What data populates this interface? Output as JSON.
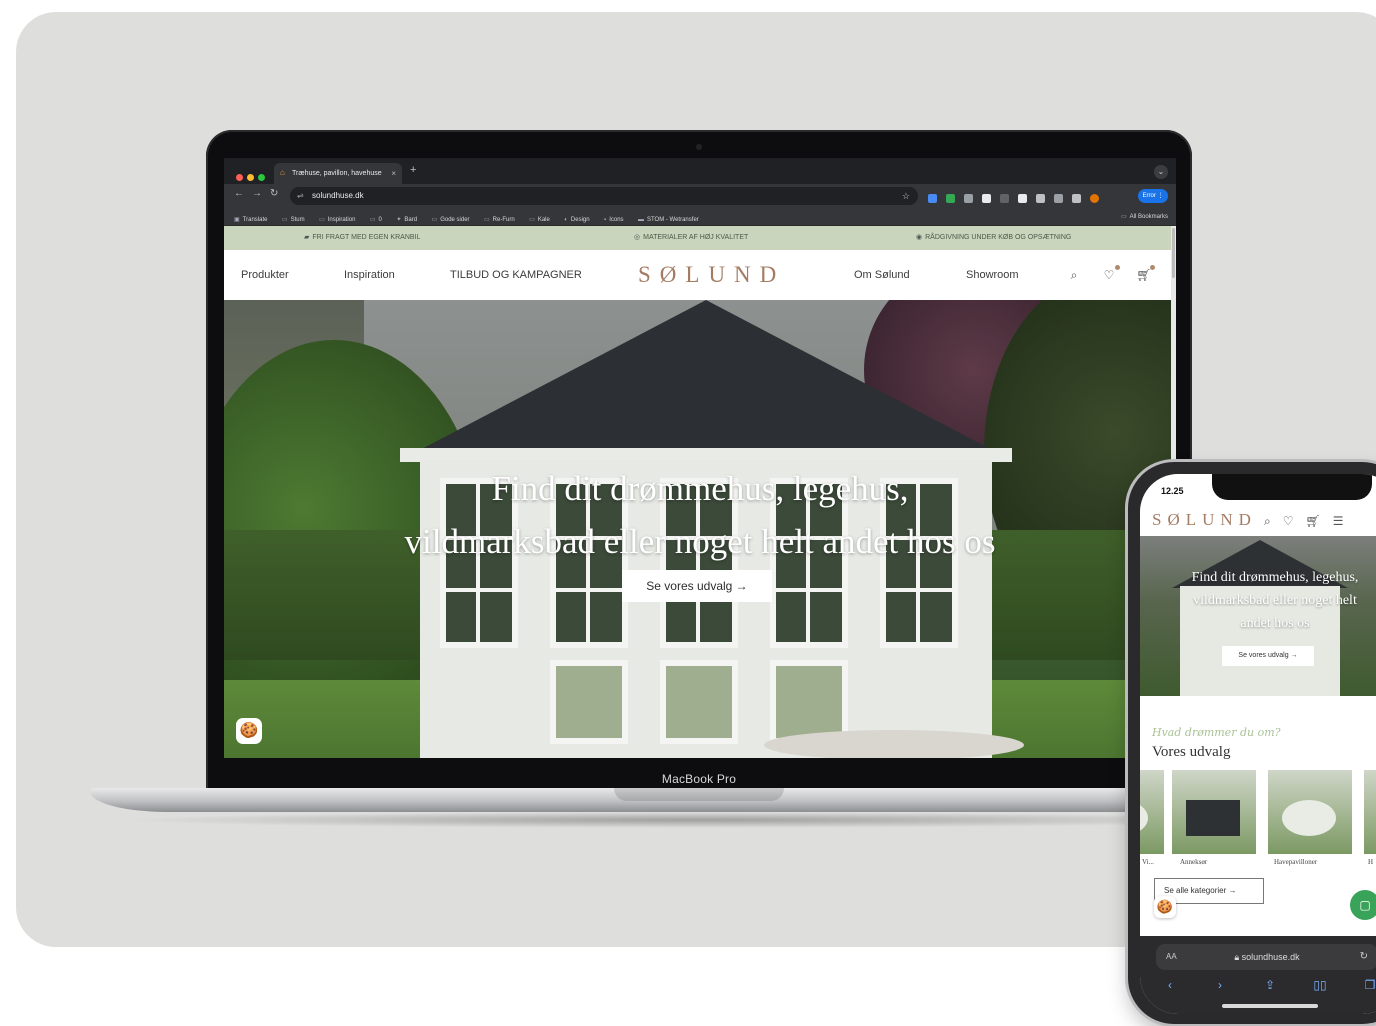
{
  "laptop": {
    "model_label": "MacBook Pro",
    "browser": {
      "tab_title": "Træhuse, pavillon, havehuse",
      "tab_close": "×",
      "new_tab": "+",
      "url": "solundhuse.dk",
      "profile_label": "Error ⋮",
      "bookmarks": [
        "Translate",
        "Stum",
        "Inspiration",
        "0",
        "Bard",
        "Gode sider",
        "Re-Furn",
        "Kale",
        "Design",
        "Icons",
        "STOM - Wetransfer"
      ],
      "bookmarks_right": "All Bookmarks"
    },
    "site": {
      "promo": [
        "FRI FRAGT MED EGEN KRANBIL",
        "MATERIALER AF HØJ KVALITET",
        "RÅDGIVNING UNDER KØB OG OPSÆTNING"
      ],
      "nav_left": [
        "Produkter",
        "Inspiration",
        "TILBUD OG KAMPAGNER"
      ],
      "logo": "SØLUND",
      "nav_right": [
        "Om Sølund",
        "Showroom"
      ],
      "hero_title_line1": "Find dit drømmehus, legehus,",
      "hero_title_line2": "vildmarksbad eller noget helt andet hos os",
      "hero_cta": "Se vores udvalg →",
      "cookie_icon": "🍪"
    }
  },
  "phone": {
    "time": "12.25",
    "status": "..ıl ᯤ ▬",
    "logo": "SØLUND",
    "hero_line1": "Find dit drømmehus, legehus,",
    "hero_line2": "vildmarksbad eller noget helt",
    "hero_line3": "andet hos os",
    "hero_cta": "Se vores udvalg →",
    "script_heading": "Hvad drømmer du om?",
    "heading": "Vores udvalg",
    "categories": [
      "Vi...",
      "Anneksør",
      "Havepavilloner",
      "H"
    ],
    "all_categories_button": "Se alle kategorier →",
    "address": "solundhuse.dk",
    "address_prefix": "AA",
    "reload": "↻"
  },
  "colors": {
    "promo_bg": "#c9d5bd",
    "logo": "#a47c63",
    "accent_green": "#3aa35a"
  },
  "icons": [
    "search-icon",
    "heart-icon",
    "cart-icon",
    "menu-icon",
    "cookie-icon",
    "chat-icon",
    "share-icon",
    "book-icon",
    "tabs-icon"
  ]
}
